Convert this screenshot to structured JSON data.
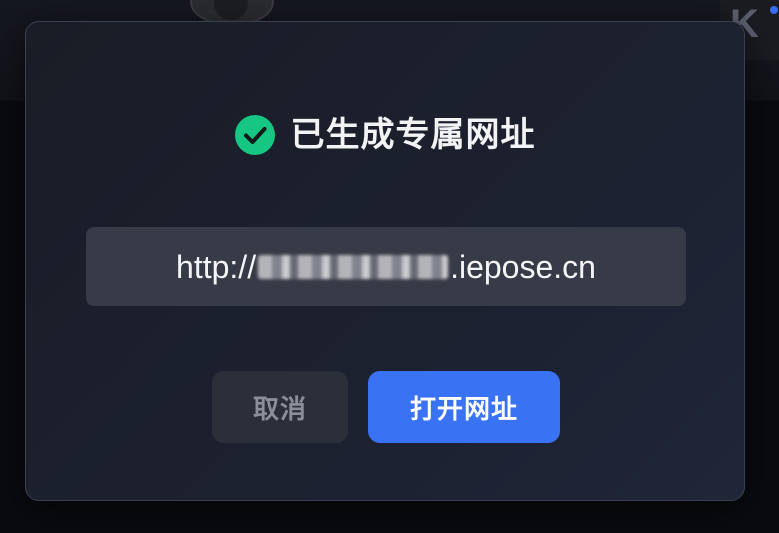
{
  "background": {
    "logo_letter": "K"
  },
  "dialog": {
    "title": "已生成专属网址",
    "success_icon": "check-circle-icon",
    "url": {
      "prefix": "http://",
      "suffix": ".iepose.cn"
    },
    "buttons": {
      "cancel_label": "取消",
      "open_label": "打开网址"
    }
  },
  "colors": {
    "success": "#16c784",
    "primary": "#3a72f4",
    "dialog_bg": "#1c2130",
    "url_box_bg": "#373b47"
  }
}
